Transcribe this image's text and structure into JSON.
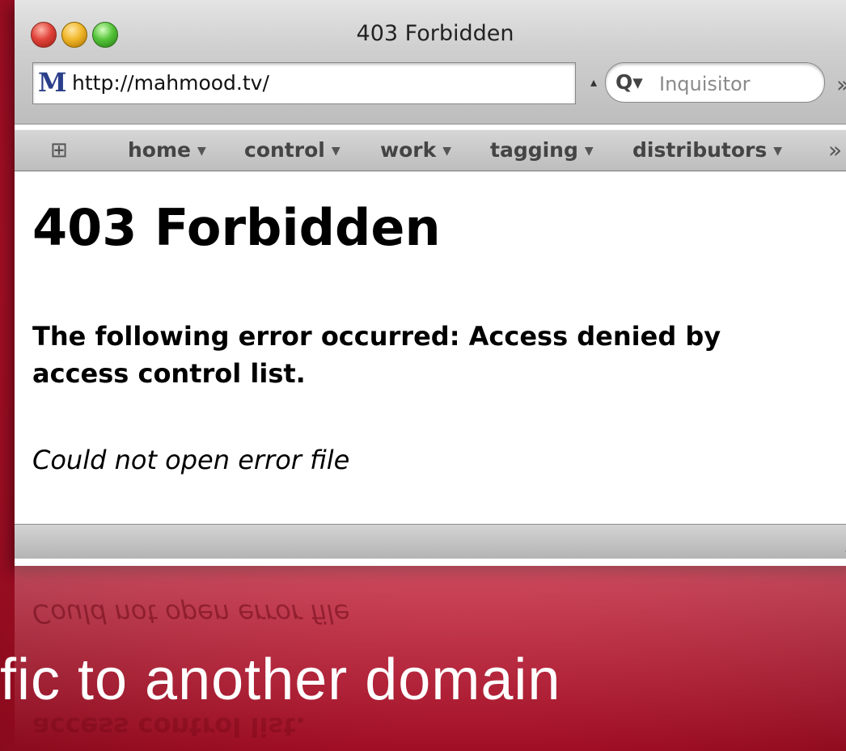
{
  "window": {
    "title": "403 Forbidden"
  },
  "toolbar": {
    "favicon_letter": "M",
    "url": "http://mahmood.tv/",
    "search_placeholder": "Inquisitor"
  },
  "bookmarks": {
    "items": [
      {
        "label": "home"
      },
      {
        "label": "control"
      },
      {
        "label": "work"
      },
      {
        "label": "tagging"
      },
      {
        "label": "distributors"
      }
    ]
  },
  "page": {
    "heading": "403 Forbidden",
    "error_message": "The following error occurred: Access denied by access control list.",
    "note": "Could not open error file"
  },
  "reflection": {
    "line1": "Could not open error file",
    "line2": "access control list."
  },
  "slide": {
    "caption": "fic to another domain"
  },
  "icons": [
    "close-icon",
    "minimize-icon",
    "zoom-icon",
    "search-icon",
    "bookmarks-book-icon",
    "chevron-more-icon",
    "resize-grip-icon"
  ],
  "colors": {
    "background": "#b3112a",
    "caption_text": "#ffffff",
    "favicon": "#2a3f8a"
  }
}
